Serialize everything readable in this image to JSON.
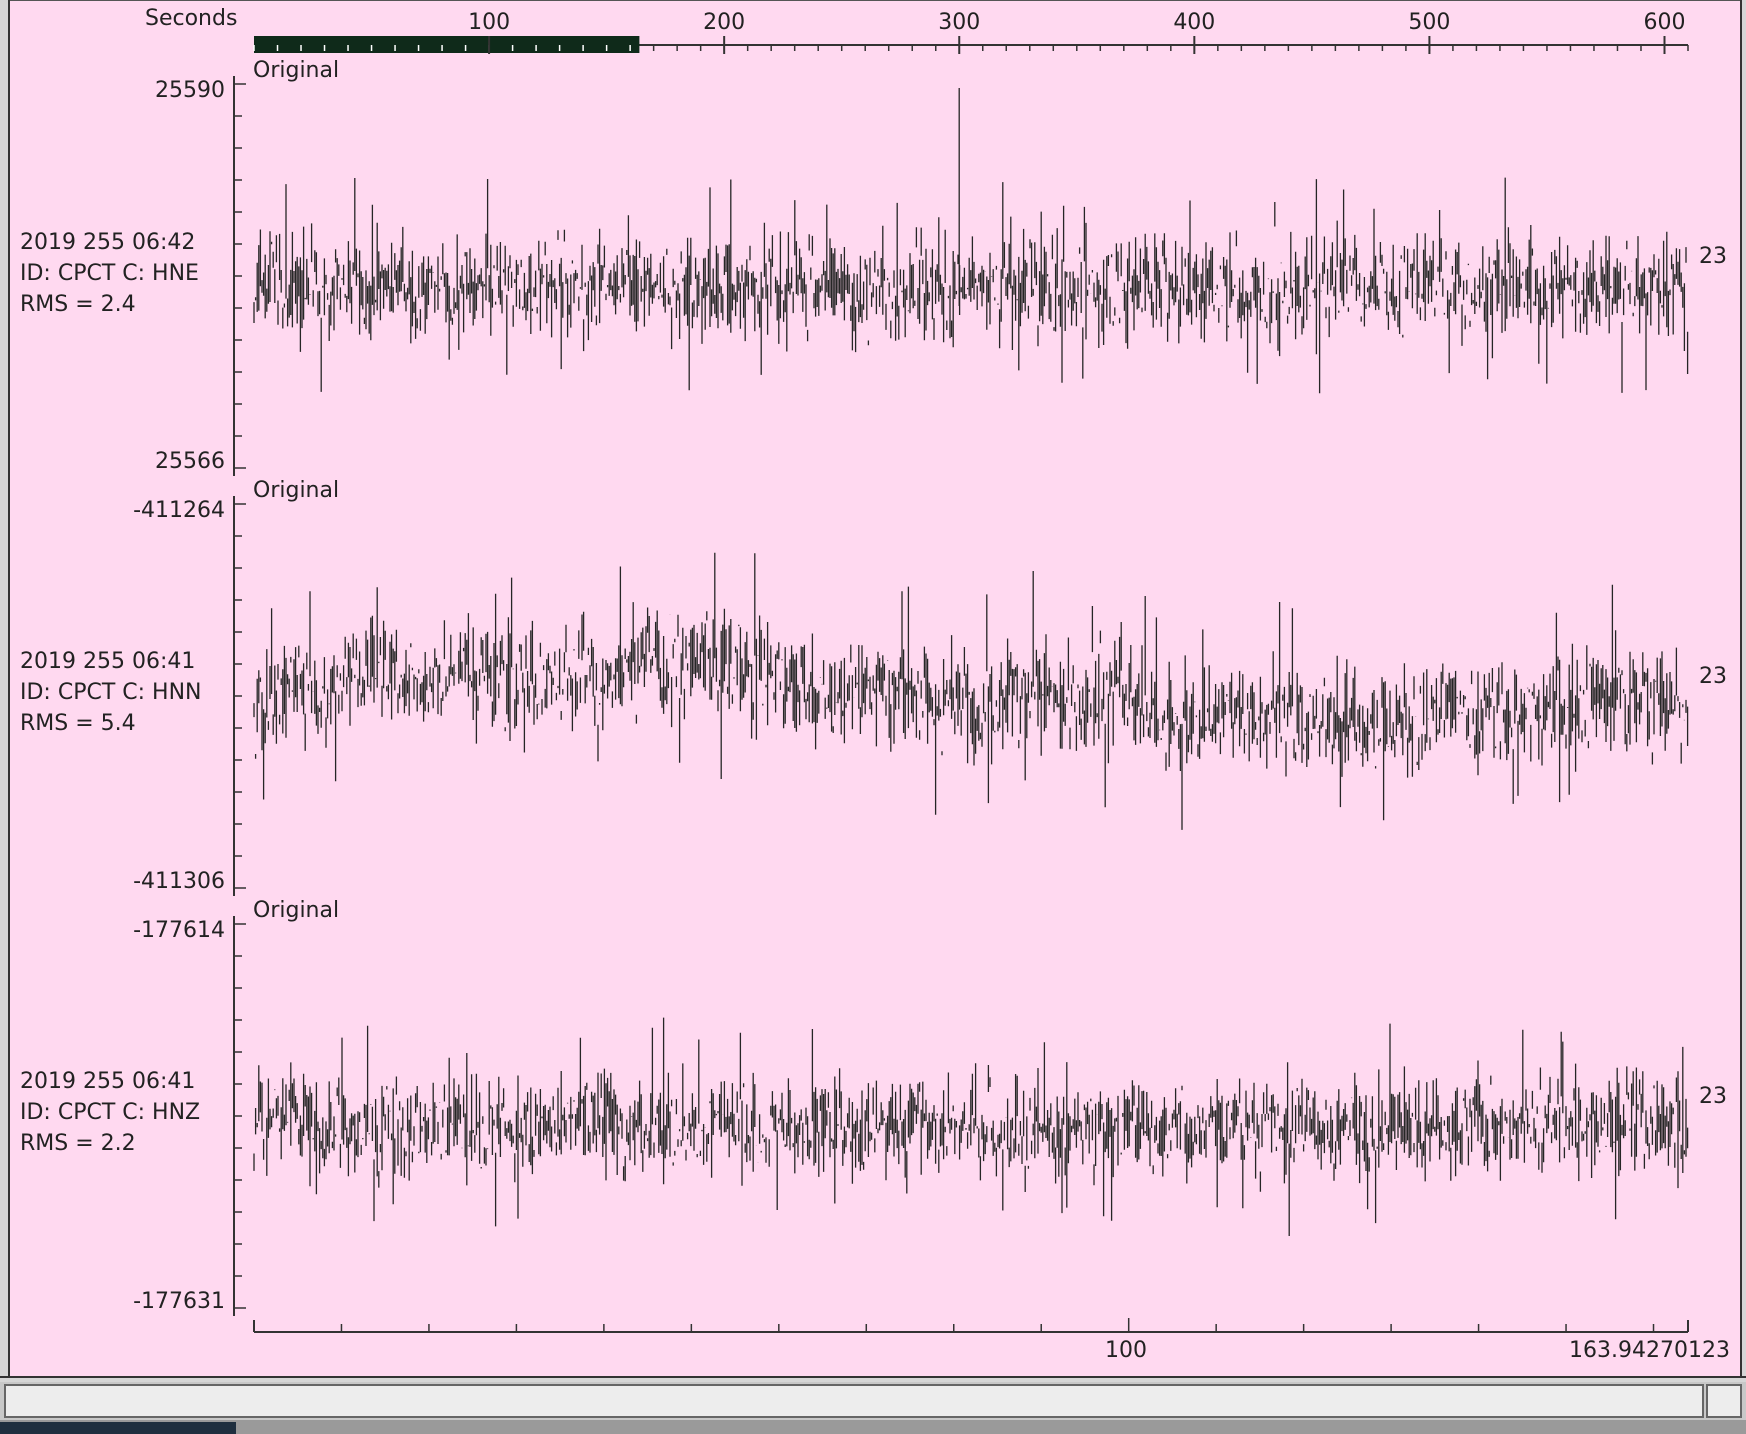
{
  "colors": {
    "background": "#ffd9f0",
    "trace": "#262626",
    "axis": "#333333",
    "scroll_thumb": "#0f2a1a"
  },
  "top_axis": {
    "label": "Seconds",
    "ticks": [
      "100",
      "200",
      "300",
      "400",
      "500",
      "600"
    ],
    "scroll_thumb_range_seconds": [
      0,
      163.94
    ]
  },
  "bottom_axis": {
    "ticks": [
      "100"
    ],
    "end_label": "163.94270123"
  },
  "traces": [
    {
      "tag": "Original",
      "date_label": "2019 255 06:42",
      "id_label": "ID: CPCT C: HNE",
      "rms_label": "RMS = 2.4",
      "ymax_label": "25590",
      "ymin_label": "25566",
      "right_label": "23",
      "style": "steady",
      "spikes_seconds": [
        300
      ]
    },
    {
      "tag": "Original",
      "date_label": "2019 255 06:41",
      "id_label": "ID: CPCT C: HNN",
      "rms_label": "RMS = 5.4",
      "ymax_label": "-411264",
      "ymin_label": "-411306",
      "right_label": "23",
      "style": "wander",
      "spikes_seconds": []
    },
    {
      "tag": "Original",
      "date_label": "2019 255 06:41",
      "id_label": "ID: CPCT C: HNZ",
      "rms_label": "RMS = 2.2",
      "ymax_label": "-177614",
      "ymin_label": "-177631",
      "right_label": "23",
      "style": "steady",
      "spikes_seconds": []
    }
  ]
}
